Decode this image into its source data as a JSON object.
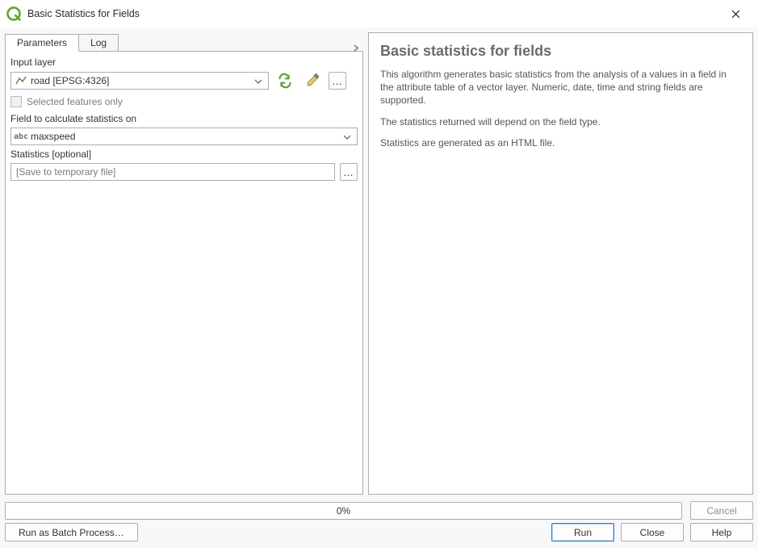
{
  "window": {
    "title": "Basic Statistics for Fields"
  },
  "tabs": {
    "parameters": "Parameters",
    "log": "Log"
  },
  "labels": {
    "input_layer": "Input layer",
    "selected_only": "Selected features only",
    "field_calc": "Field to calculate statistics on",
    "stats_opt": "Statistics [optional]"
  },
  "values": {
    "input_layer": "road [EPSG:4326]",
    "field": "maxspeed",
    "stats_placeholder": "[Save to temporary file]"
  },
  "help": {
    "title": "Basic statistics for fields",
    "p1": "This algorithm generates basic statistics from the analysis of a values in a field in the attribute table of a vector layer. Numeric, date, time and string fields are supported.",
    "p2": "The statistics returned will depend on the field type.",
    "p3": "Statistics are generated as an HTML file."
  },
  "progress": {
    "text": "0%"
  },
  "buttons": {
    "cancel": "Cancel",
    "batch": "Run as Batch Process…",
    "run": "Run",
    "close": "Close",
    "help_btn": "Help"
  },
  "icons": {
    "line_layer": "line-layer-icon",
    "reload": "reload-icon",
    "wrench": "wrench-icon",
    "more": "more-icon",
    "abc": "abc"
  }
}
